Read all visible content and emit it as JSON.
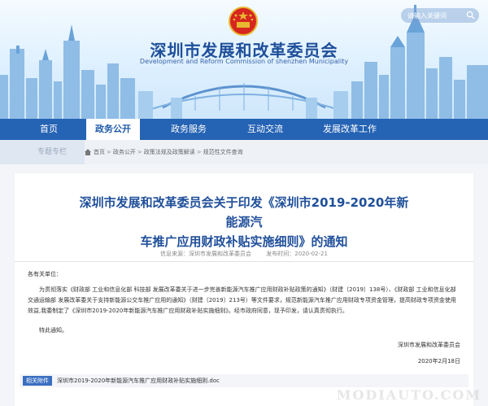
{
  "header": {
    "site_title": "深圳市发展和改革委员会",
    "site_subtitle": "Development and Reform Commission of shenzhen Municipality",
    "search_placeholder": "请输入关键词"
  },
  "nav": {
    "items": [
      {
        "label": "首页",
        "active": false
      },
      {
        "label": "政务公开",
        "active": true
      },
      {
        "label": "政务服务",
        "active": false
      },
      {
        "label": "互动交流",
        "active": false
      },
      {
        "label": "发展改革工作",
        "active": false
      }
    ]
  },
  "breadcrumb": {
    "section_label": "专题专栏",
    "items": [
      "首页",
      "政务公开",
      "政策法规及政策解读",
      "规范性文件查询"
    ]
  },
  "article": {
    "title_line1": "深圳市发展和改革委员会关于印发《深圳市2019-2020年新能源汽",
    "title_line2": "车推广应用财政补贴实施细则》的通知",
    "source": "信息来源：深圳市发展和改革委员会",
    "published": "发布时间：2020-02-21",
    "greeting": "各有关单位：",
    "body": "为贯彻落实《财政部 工业和信息化部 科技部 发展改革委关于进一步完善新能源汽车推广应用财政补贴政策的通知》（财建〔2019〕138号）、《财政部 工业和信息化部交通运输部 发展改革委关于支持新能源公交车推广应用的通知》（财建〔2019〕213号）等文件要求，规范新能源汽车推广应用财政专项资金管理，提高财政专项资金使用效益,我委制定了《深圳市2019-2020年新能源汽车推广应用财政补贴实施细则》。经市政府同意，现予印发，请认真贯彻执行。",
    "closing": "特此通知。",
    "signature": "深圳市发展和改革委员会",
    "date": "2020年2月18日"
  },
  "attachment": {
    "tag": "相关附件",
    "file": "深圳市2019-2020年新能源汽车推广应用财政补贴实施细则.doc"
  },
  "watermark": "MODIAUTO.COM",
  "colors": {
    "nav_bg": "#2563b4",
    "title_blue": "#1f4f9a",
    "emblem_red": "#d6261f"
  }
}
